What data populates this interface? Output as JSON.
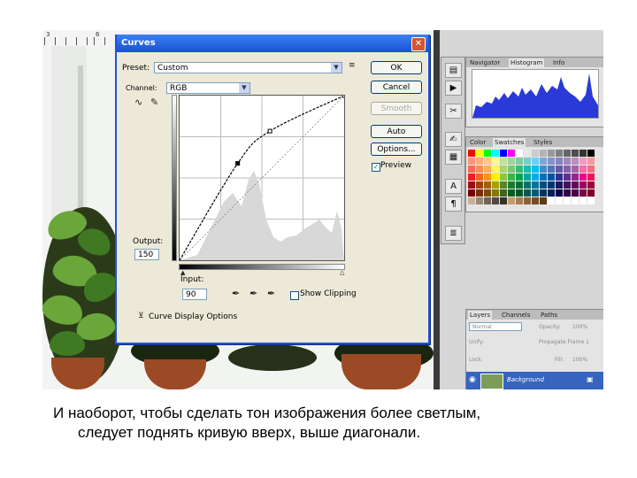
{
  "dialog": {
    "title": "Curves",
    "close_glyph": "✕",
    "preset_label": "Preset:",
    "preset_value": "Custom",
    "channel_label": "Channel:",
    "channel_value": "RGB",
    "buttons": {
      "ok": "OK",
      "cancel": "Cancel",
      "smooth": "Smooth",
      "auto": "Auto",
      "options": "Options..."
    },
    "preview_label": "Preview",
    "preview_checked": true,
    "output_label": "Output:",
    "output_value": "150",
    "input_label": "Input:",
    "input_value": "90",
    "show_clipping_label": "Show Clipping",
    "curve_display_label": "Curve Display Options",
    "curve": {
      "control_points": [
        [
          0,
          0
        ],
        [
          90,
          150
        ],
        [
          140,
          200
        ],
        [
          255,
          255
        ]
      ]
    }
  },
  "panels": {
    "top_tabs": [
      "Navigator",
      "Histogram",
      "Info"
    ],
    "mid_tabs": [
      "Color",
      "Swatches",
      "Styles"
    ],
    "layers_tabs": [
      "Layers",
      "Channels",
      "Paths"
    ],
    "blend_mode": "Normal",
    "opacity_label": "Opacity:",
    "opacity_value": "100%",
    "unify_label": "Unify:",
    "propagate_label": "Propagate Frame 1",
    "lock_label": "Lock:",
    "fill_label": "Fill:",
    "fill_value": "100%",
    "layer_name": "Background"
  },
  "ruler": {
    "nums": [
      "3",
      "6"
    ]
  },
  "caption": {
    "line1": "И наоборот, чтобы сделать тон изображения более светлым,",
    "line2": "следует поднять кривую вверх, выше диагонали."
  },
  "colors": {
    "accent": "#1652d4",
    "histogram": "#2a3ad8"
  }
}
